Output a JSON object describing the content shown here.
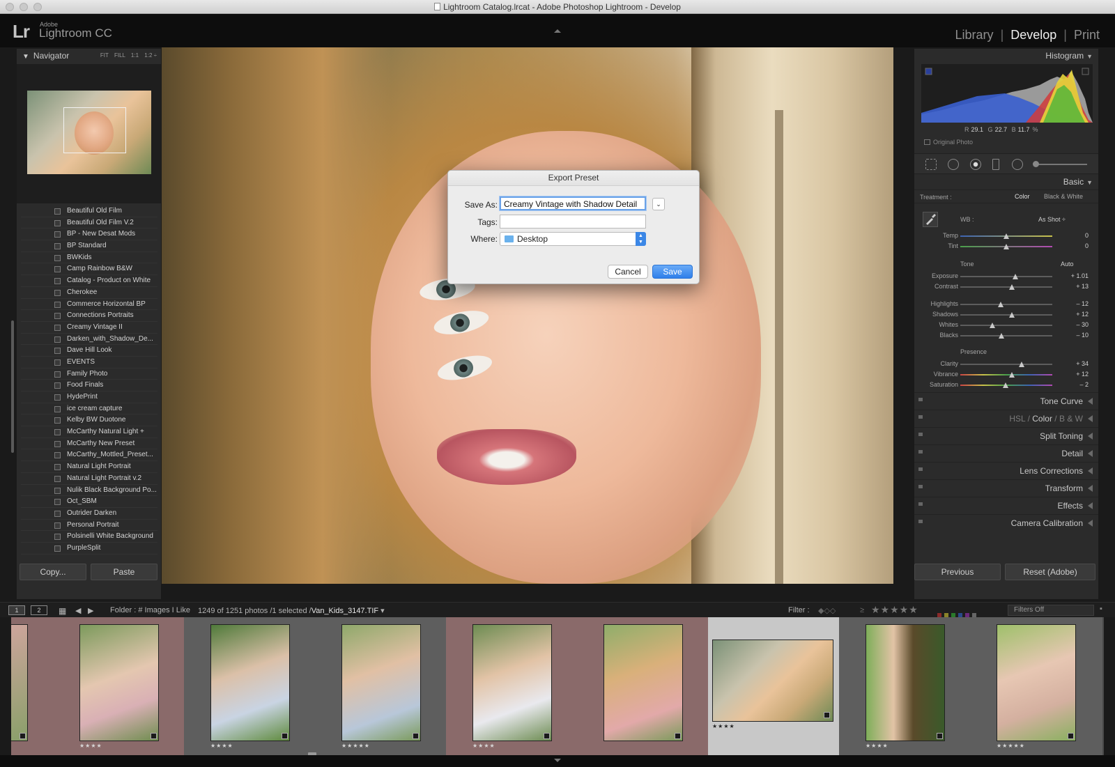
{
  "window": {
    "title": "Lightroom Catalog.lrcat - Adobe Photoshop Lightroom - Develop"
  },
  "brand": {
    "logo": "Lr",
    "company": "Adobe",
    "product": "Lightroom CC"
  },
  "modules": {
    "library": "Library",
    "develop": "Develop",
    "print": "Print",
    "separator": "|"
  },
  "navigator": {
    "title": "Navigator",
    "options": [
      "FIT",
      "FILL",
      "1:1",
      "1:2 ÷"
    ]
  },
  "presets": [
    "Beautiful Old Film",
    "Beautiful Old Film V.2",
    "BP - New Desat Mods",
    "BP Standard",
    "BWKids",
    "Camp Rainbow B&W",
    "Catalog - Product on White",
    "Cherokee",
    "Commerce Horizontal BP",
    "Connections Portraits",
    "Creamy Vintage II",
    "Darken_with_Shadow_De...",
    "Dave Hill Look",
    "EVENTS",
    "Family Photo",
    "Food Finals",
    "HydePrint",
    "ice cream capture",
    "Kelby BW Duotone",
    "McCarthy Natural Light +",
    "McCarthy New Preset",
    "McCarthy_Mottled_Preset...",
    "Natural Light Portrait",
    "Natural Light Portrait v.2",
    "Nulik Black Background Po...",
    "Oct_SBM",
    "Outrider Darken",
    "Personal Portrait",
    "Polsinelli White Background",
    "PurpleSplit"
  ],
  "left_buttons": {
    "copy": "Copy...",
    "paste": "Paste"
  },
  "dialog": {
    "title": "Export Preset",
    "save_as_label": "Save As:",
    "save_as_value": "Creamy Vintage with Shadow Detail",
    "tags_label": "Tags:",
    "tags_value": "",
    "where_label": "Where:",
    "where_value": "Desktop",
    "cancel": "Cancel",
    "save": "Save"
  },
  "histogram": {
    "title": "Histogram",
    "r_label": "R",
    "r": "29.1",
    "g_label": "G",
    "g": "22.7",
    "b_label": "B",
    "b": "11.7",
    "unit": "%",
    "original_photo": "Original Photo"
  },
  "basic": {
    "title": "Basic",
    "treatment_label": "Treatment :",
    "color": "Color",
    "bw": "Black & White",
    "wb_label": "WB :",
    "wb_value": "As Shot ÷",
    "tone_label": "Tone",
    "auto": "Auto",
    "presence_label": "Presence",
    "sliders": {
      "temp": {
        "label": "Temp",
        "value": "0",
        "pos": 0.5
      },
      "tint": {
        "label": "Tint",
        "value": "0",
        "pos": 0.5
      },
      "exposure": {
        "label": "Exposure",
        "value": "+ 1.01",
        "pos": 0.6
      },
      "contrast": {
        "label": "Contrast",
        "value": "+ 13",
        "pos": 0.56
      },
      "highlights": {
        "label": "Highlights",
        "value": "– 12",
        "pos": 0.44
      },
      "shadows": {
        "label": "Shadows",
        "value": "+ 12",
        "pos": 0.56
      },
      "whites": {
        "label": "Whites",
        "value": "– 30",
        "pos": 0.35
      },
      "blacks": {
        "label": "Blacks",
        "value": "– 10",
        "pos": 0.45
      },
      "clarity": {
        "label": "Clarity",
        "value": "+ 34",
        "pos": 0.67
      },
      "vibrance": {
        "label": "Vibrance",
        "value": "+ 12",
        "pos": 0.56
      },
      "saturation": {
        "label": "Saturation",
        "value": "– 2",
        "pos": 0.49
      }
    }
  },
  "panels": {
    "tone_curve": "Tone Curve",
    "hsl": "HSL",
    "hsl_color": "Color",
    "hsl_bw": "B & W",
    "slash": "/",
    "split_toning": "Split Toning",
    "detail": "Detail",
    "lens_corrections": "Lens Corrections",
    "transform": "Transform",
    "effects": "Effects",
    "camera_calibration": "Camera Calibration"
  },
  "right_buttons": {
    "previous": "Previous",
    "reset": "Reset (Adobe)"
  },
  "filmbar": {
    "screen1": "1",
    "screen2": "2",
    "folder": "Folder : # Images I Like",
    "count": "1249 of 1251 photos /1 selected /",
    "filename": "Van_Kids_3147.TIF",
    "filter_label": "Filter :",
    "rating_op": "≥",
    "filters_off": "Filters Off"
  },
  "filmstrip": [
    {
      "stars": "",
      "selected": false,
      "pink": true
    },
    {
      "stars": "★★★★",
      "selected": false,
      "pink": true
    },
    {
      "stars": "★★★★",
      "selected": false,
      "pink": false
    },
    {
      "stars": "★★★★★",
      "selected": false,
      "pink": false
    },
    {
      "stars": "★★★★",
      "selected": false,
      "pink": true
    },
    {
      "stars": "",
      "selected": false,
      "pink": true
    },
    {
      "stars": "★★★★",
      "selected": true,
      "pink": false
    },
    {
      "stars": "★★★★",
      "selected": false,
      "pink": false
    },
    {
      "stars": "★★★★★",
      "selected": false,
      "pink": false
    }
  ],
  "colors": {
    "accent": "#3b87e6",
    "panel": "#2b2b2b",
    "background": "#1a1a1a"
  }
}
